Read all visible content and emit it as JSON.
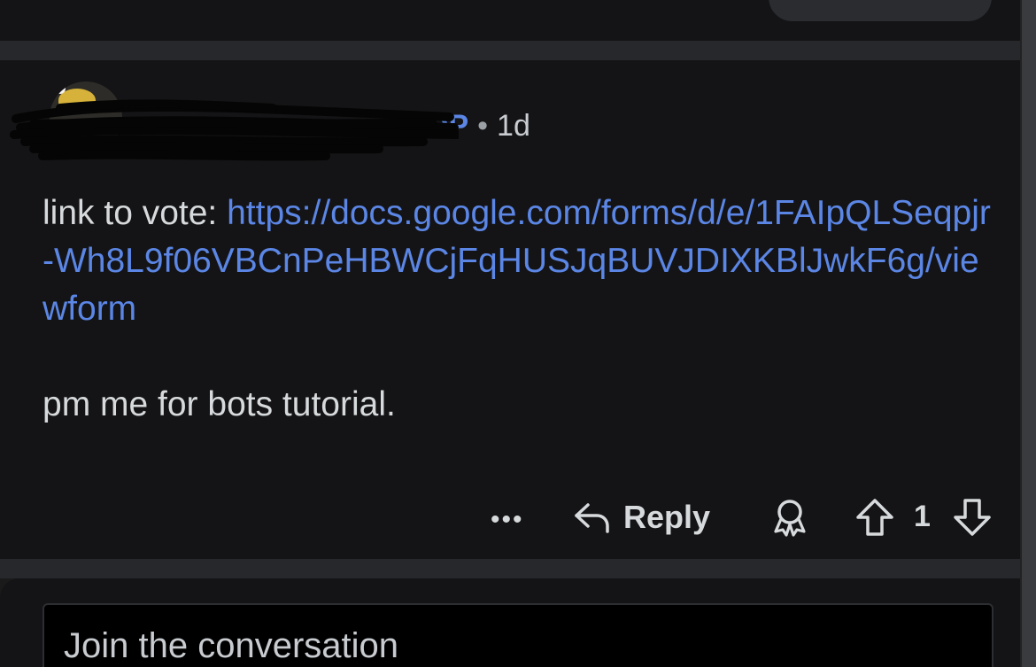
{
  "comment": {
    "author_badge": "OP",
    "separator": "•",
    "age": "1d",
    "body_prefix": "link to vote: ",
    "link_text": "https://docs.google.com/forms/d/e/1FAIpQLSeqpjr-Wh8L9f06VBCnPeHBWCjFqHUSJqBUVJDIXKBlJwkF6g/viewform",
    "body_text": "pm me for bots tutorial."
  },
  "actions": {
    "more_label": "•••",
    "reply_label": "Reply",
    "score": "1"
  },
  "composer": {
    "placeholder": "Join the conversation"
  },
  "icons": [
    "more-icon",
    "reply-arrow-icon",
    "award-icon",
    "upvote-icon",
    "downvote-icon"
  ],
  "colors": {
    "background": "#141416",
    "link": "#5b86e5",
    "text": "#d7dadc",
    "muted": "#9aa0a6"
  }
}
